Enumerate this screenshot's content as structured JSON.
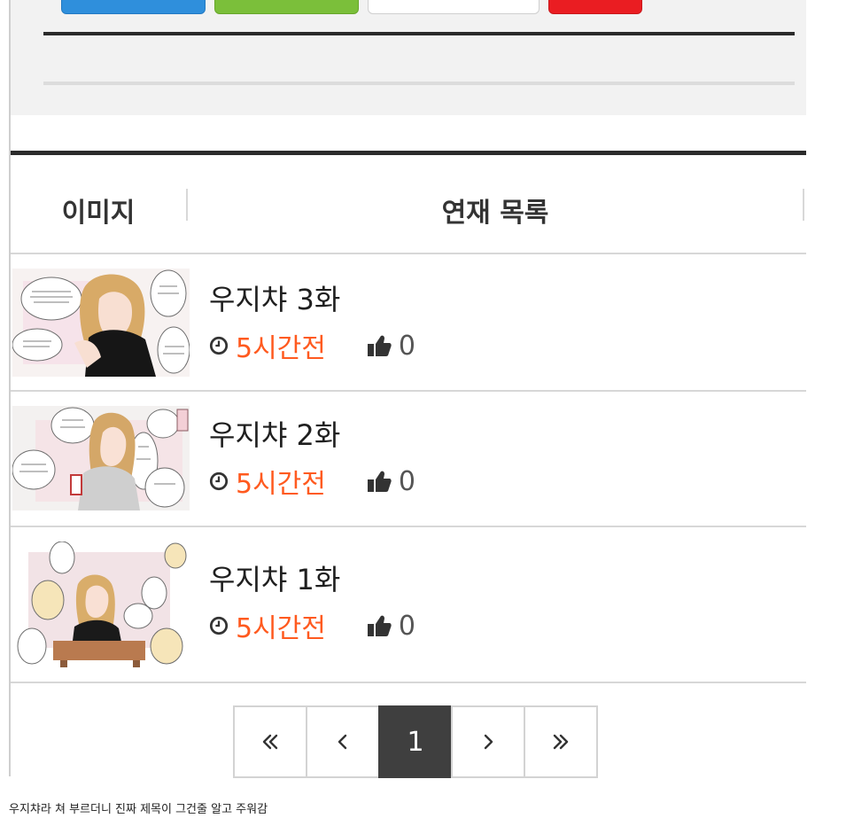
{
  "list_header": {
    "image_label": "이미지",
    "list_label": "연재 목록"
  },
  "episodes": [
    {
      "title": "우지챠 3화",
      "time": "5시간전",
      "likes": "0"
    },
    {
      "title": "우지챠 2화",
      "time": "5시간전",
      "likes": "0"
    },
    {
      "title": "우지챠 1화",
      "time": "5시간전",
      "likes": "0"
    }
  ],
  "pagination": {
    "current": "1",
    "first_icon": "double-chevron-left-icon",
    "prev_icon": "chevron-left-icon",
    "next_icon": "chevron-right-icon",
    "last_icon": "double-chevron-right-icon"
  },
  "caption": "우지챠라 쳐 부르더니 진짜 제목이 그건줄 알고 주워감",
  "colors": {
    "accent_time": "#ff5a1f",
    "btn_blue": "#2f8fdc",
    "btn_green": "#7bbf3a",
    "btn_red": "#ea1d22",
    "active_page": "#3f3f3f"
  }
}
